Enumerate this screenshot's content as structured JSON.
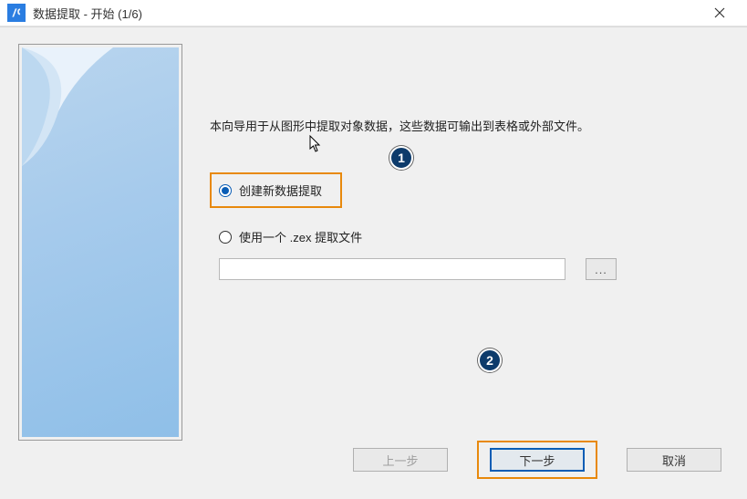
{
  "window": {
    "title": "数据提取 - 开始 (1/6)"
  },
  "intro": "本向导用于从图形中提取对象数据，这些数据可输出到表格或外部文件。",
  "options": {
    "create_new": "创建新数据提取",
    "use_existing": "使用一个 .zex 提取文件"
  },
  "browse_label": "...",
  "file_path_value": "",
  "buttons": {
    "prev": "上一步",
    "next": "下一步",
    "cancel": "取消"
  },
  "callouts": {
    "one": "1",
    "two": "2"
  }
}
